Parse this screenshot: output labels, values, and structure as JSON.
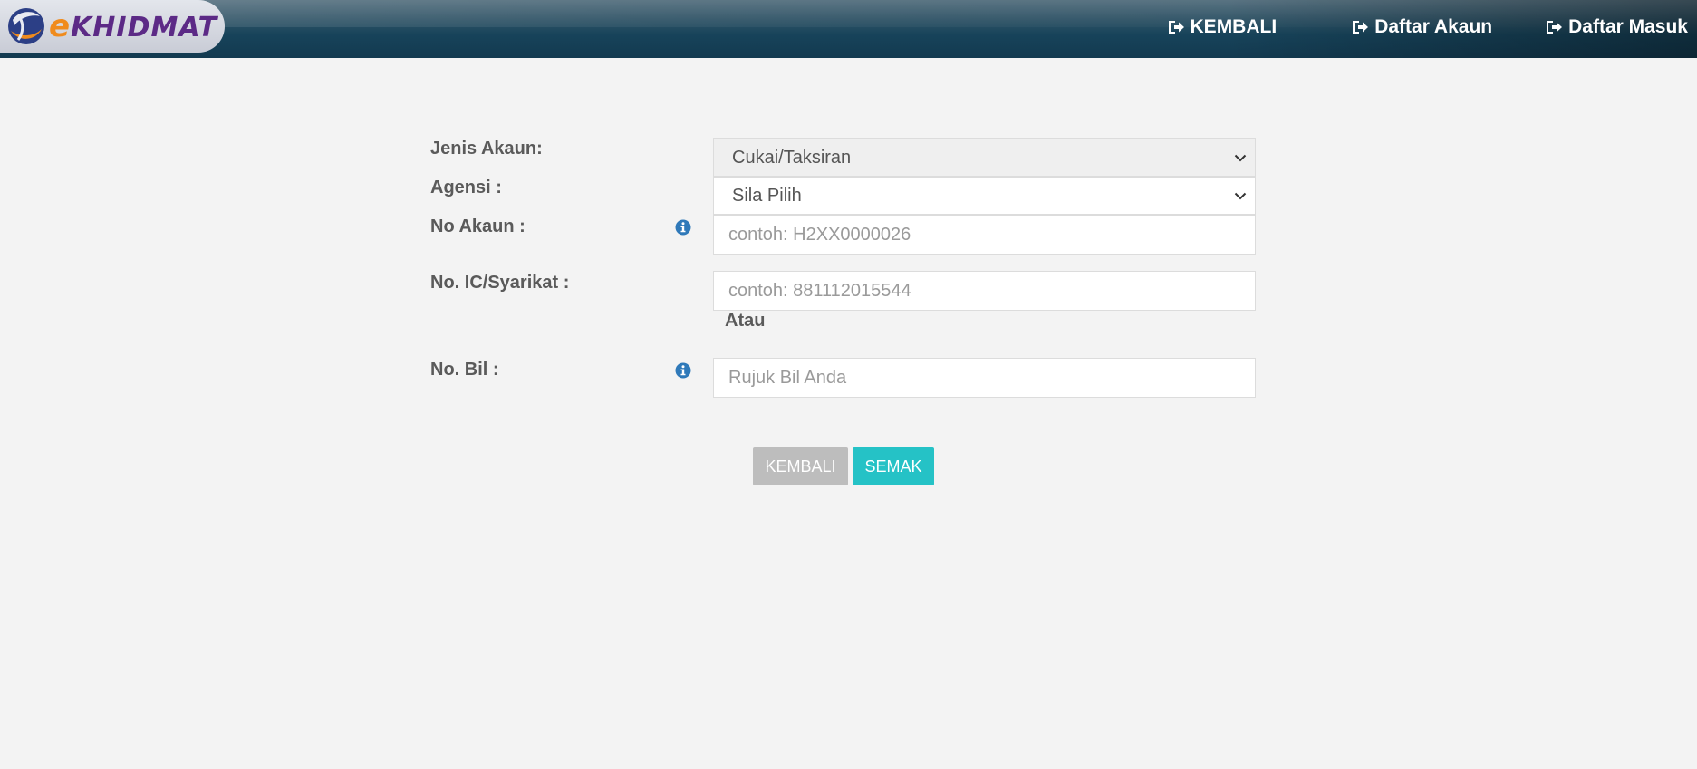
{
  "header": {
    "logo_text_e": "e",
    "logo_text_rest": "KHIDMAT",
    "nav": [
      {
        "label": "KEMBALI",
        "icon": "sign-out-icon"
      },
      {
        "label": "Daftar Akaun",
        "icon": "sign-out-icon"
      },
      {
        "label": "Daftar Masuk",
        "icon": "sign-out-icon"
      }
    ]
  },
  "form": {
    "jenis_akaun": {
      "label": "Jenis Akaun:",
      "selected": "Cukai/Taksiran"
    },
    "agensi": {
      "label": "Agensi :",
      "selected": "Sila Pilih"
    },
    "no_akaun": {
      "label": "No Akaun :",
      "placeholder": "contoh: H2XX0000026"
    },
    "no_ic": {
      "label": "No. IC/Syarikat :",
      "placeholder": "contoh: 881112015544"
    },
    "atau": "Atau",
    "no_bil": {
      "label": "No. Bil :",
      "placeholder": "Rujuk Bil Anda"
    }
  },
  "buttons": {
    "back_label": "KEMBALI",
    "check_label": "SEMAK"
  },
  "colors": {
    "check_button": "#25c2c6",
    "back_button": "#bdbdbd",
    "info_icon": "#2f79b9",
    "logo_purple": "#5c2a86",
    "logo_orange": "#f08b1d"
  }
}
